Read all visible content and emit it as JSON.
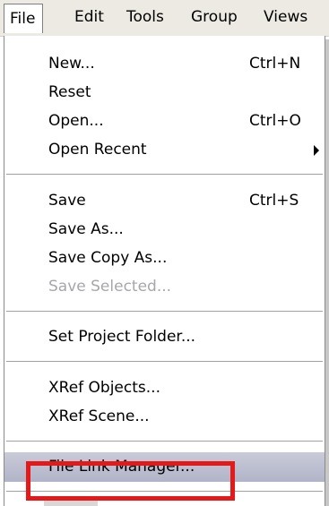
{
  "menubar": {
    "items": [
      {
        "label": "File"
      },
      {
        "label": "Edit"
      },
      {
        "label": "Tools"
      },
      {
        "label": "Group"
      },
      {
        "label": "Views"
      }
    ]
  },
  "file_menu": {
    "items": [
      {
        "label": "New...",
        "shortcut": "Ctrl+N"
      },
      {
        "label": "Reset",
        "shortcut": ""
      },
      {
        "label": "Open...",
        "shortcut": "Ctrl+O"
      },
      {
        "label": "Open Recent",
        "shortcut": "",
        "submenu": true
      },
      {
        "label": "Save",
        "shortcut": "Ctrl+S"
      },
      {
        "label": "Save As...",
        "shortcut": ""
      },
      {
        "label": "Save Copy As...",
        "shortcut": ""
      },
      {
        "label": "Save Selected...",
        "shortcut": "",
        "disabled": true
      },
      {
        "label": "Set Project Folder...",
        "shortcut": ""
      },
      {
        "label": "XRef Objects...",
        "shortcut": ""
      },
      {
        "label": "XRef Scene...",
        "shortcut": ""
      },
      {
        "label": "File Link Manager...",
        "shortcut": "",
        "highlighted": true
      }
    ]
  },
  "colors": {
    "highlight_box": "#e41a1a",
    "highlight_row": "#b8bbcc",
    "disabled_text": "#a7a6aa"
  }
}
